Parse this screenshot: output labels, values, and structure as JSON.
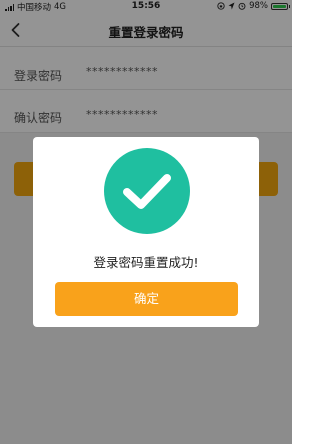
{
  "status_bar": {
    "carrier": "中国移动",
    "network": "4G",
    "time": "15:56",
    "battery_percent": "98%",
    "battery_level": 0.98,
    "battery_color": "#2ecc4e"
  },
  "nav": {
    "back_icon": "chevron-left-icon",
    "title": "重置登录密码"
  },
  "form": {
    "rows": [
      {
        "label": "登录密码",
        "value": "************"
      },
      {
        "label": "确认密码",
        "value": "************"
      }
    ],
    "submit_color": "#f3a70f"
  },
  "dialog": {
    "icon": "check-circle-icon",
    "icon_color": "#1fbfa0",
    "message": "登录密码重置成功!",
    "confirm_label": "确定",
    "confirm_color": "#f9a21b"
  }
}
